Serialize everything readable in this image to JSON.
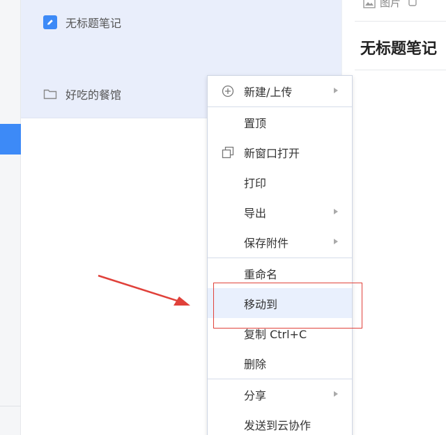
{
  "sidebar": {
    "active_color": "#3d8af7"
  },
  "list": {
    "items": [
      {
        "label": "无标题笔记",
        "icon": "note-icon"
      },
      {
        "label": "好吃的餐馆",
        "icon": "folder-icon"
      }
    ]
  },
  "main": {
    "toolbar": [
      {
        "label": "图片",
        "icon": "image-icon"
      },
      {
        "label": "",
        "icon": "attachment-icon"
      }
    ],
    "note_title": "无标题笔记"
  },
  "context_menu": {
    "items": [
      {
        "label": "新建/上传",
        "icon": "plus-circle-icon",
        "submenu": true
      },
      {
        "label": "置顶"
      },
      {
        "label": "新窗口打开",
        "icon": "new-window-icon"
      },
      {
        "label": "打印"
      },
      {
        "label": "导出",
        "submenu": true
      },
      {
        "label": "保存附件",
        "submenu": true
      },
      {
        "label": "重命名"
      },
      {
        "label": "移动到",
        "highlighted": true
      },
      {
        "label": "复制 Ctrl+C"
      },
      {
        "label": "删除"
      },
      {
        "label": "分享",
        "submenu": true
      },
      {
        "label": "发送到云协作"
      }
    ]
  },
  "annotation": {
    "color": "#e0413a"
  }
}
